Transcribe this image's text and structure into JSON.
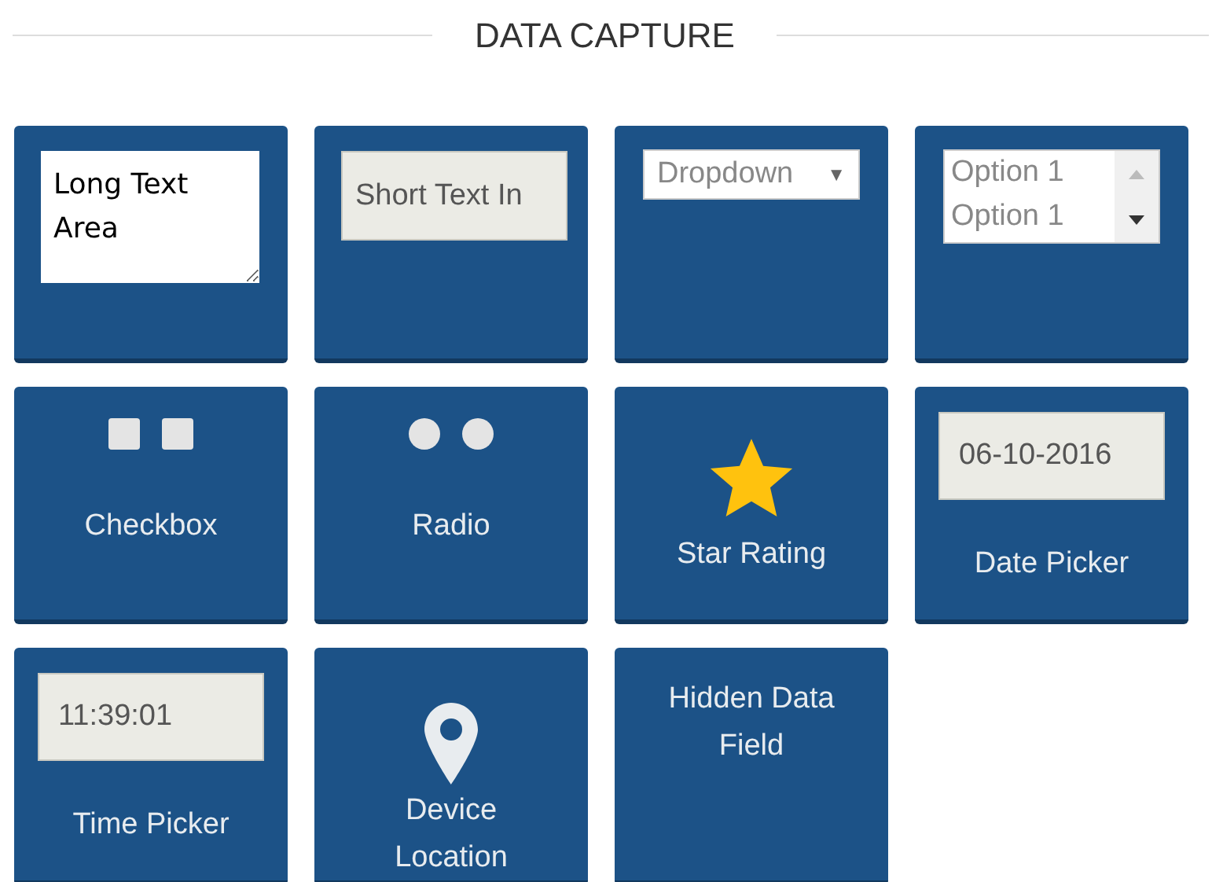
{
  "heading": "DATA CAPTURE",
  "tiles": [
    {
      "kind": "textarea",
      "value": "Long Text Area"
    },
    {
      "kind": "text_input",
      "value": "Short Text In"
    },
    {
      "kind": "dropdown",
      "value": "Dropdown",
      "arrow": "▼"
    },
    {
      "kind": "listbox",
      "options": [
        "Option 1",
        "Option 1"
      ]
    },
    {
      "kind": "checkbox",
      "label": "Checkbox"
    },
    {
      "kind": "radio",
      "label": "Radio"
    },
    {
      "kind": "star",
      "label": "Star Rating"
    },
    {
      "kind": "date",
      "value": "06-10-2016",
      "label": "Date Picker"
    },
    {
      "kind": "time",
      "value": "11:39:01",
      "label": "Time Picker"
    },
    {
      "kind": "location",
      "label": "Device Location"
    },
    {
      "kind": "hidden",
      "label": "Hidden Data Field"
    }
  ]
}
